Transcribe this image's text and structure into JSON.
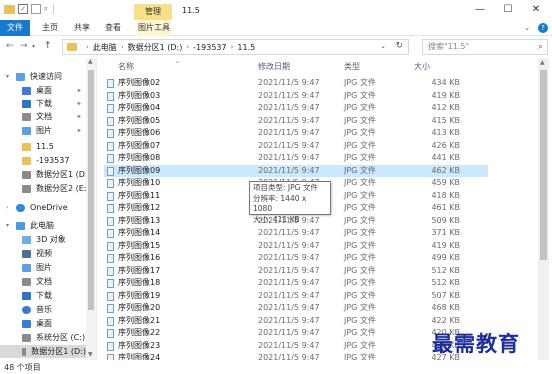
{
  "window": {
    "title": "11.5",
    "context_tab": "管理",
    "minimize_glyph": "—",
    "maximize_glyph": "☐",
    "close_glyph": "✕"
  },
  "ribbon": {
    "tabs": [
      "文件",
      "主页",
      "共享",
      "查看",
      "图片工具"
    ]
  },
  "address": {
    "crumbs": [
      "此电脑",
      "数据分区1 (D:)",
      "-193537",
      "11.5"
    ],
    "search_placeholder": "搜索\"11.5\""
  },
  "sidebar": {
    "items": [
      {
        "label": "快速访问",
        "icon": "star-icon"
      },
      {
        "label": "桌面",
        "icon": "desktop-icon",
        "pinned": true
      },
      {
        "label": "下载",
        "icon": "download-icon",
        "pinned": true
      },
      {
        "label": "文档",
        "icon": "document-icon",
        "pinned": true
      },
      {
        "label": "图片",
        "icon": "picture-icon",
        "pinned": true
      },
      {
        "label": "11.5",
        "icon": "folder-icon"
      },
      {
        "label": "-193537",
        "icon": "folder-icon"
      },
      {
        "label": "数据分区1 (D:)",
        "icon": "drive-icon"
      },
      {
        "label": "数据分区2 (E:)",
        "icon": "drive-icon"
      },
      {
        "label": "OneDrive",
        "icon": "cloud-icon"
      },
      {
        "label": "此电脑",
        "icon": "computer-icon"
      },
      {
        "label": "3D 对象",
        "icon": "cube-icon"
      },
      {
        "label": "视频",
        "icon": "video-icon"
      },
      {
        "label": "图片",
        "icon": "picture-icon"
      },
      {
        "label": "文档",
        "icon": "document-icon"
      },
      {
        "label": "下载",
        "icon": "download-icon"
      },
      {
        "label": "音乐",
        "icon": "music-icon"
      },
      {
        "label": "桌面",
        "icon": "desktop-icon"
      },
      {
        "label": "系统分区 (C:)",
        "icon": "drive-icon"
      },
      {
        "label": "数据分区1 (D:)",
        "icon": "drive-icon"
      }
    ]
  },
  "columns": {
    "name": "名称",
    "date": "修改日期",
    "type": "类型",
    "size": "大小"
  },
  "files": [
    {
      "name": "序列图像02",
      "date": "2021/11/5 9:47",
      "type": "JPG 文件",
      "size": "434 KB"
    },
    {
      "name": "序列图像03",
      "date": "2021/11/5 9:47",
      "type": "JPG 文件",
      "size": "419 KB"
    },
    {
      "name": "序列图像04",
      "date": "2021/11/5 9:47",
      "type": "JPG 文件",
      "size": "412 KB"
    },
    {
      "name": "序列图像05",
      "date": "2021/11/5 9:47",
      "type": "JPG 文件",
      "size": "415 KB"
    },
    {
      "name": "序列图像06",
      "date": "2021/11/5 9:47",
      "type": "JPG 文件",
      "size": "413 KB"
    },
    {
      "name": "序列图像07",
      "date": "2021/11/5 9:47",
      "type": "JPG 文件",
      "size": "426 KB"
    },
    {
      "name": "序列图像08",
      "date": "2021/11/5 9:47",
      "type": "JPG 文件",
      "size": "441 KB"
    },
    {
      "name": "序列图像09",
      "date": "2021/11/5 9:47",
      "type": "JPG 文件",
      "size": "462 KB"
    },
    {
      "name": "序列图像10",
      "date": "2021/11/5 9:47",
      "type": "JPG 文件",
      "size": "459 KB"
    },
    {
      "name": "序列图像11",
      "date": "2021/11/5 9:47",
      "type": "JPG 文件",
      "size": "418 KB"
    },
    {
      "name": "序列图像12",
      "date": "2021/11/5 9:47",
      "type": "JPG 文件",
      "size": "461 KB"
    },
    {
      "name": "序列图像13",
      "date": "2021/11/5 9:47",
      "type": "JPG 文件",
      "size": "509 KB"
    },
    {
      "name": "序列图像14",
      "date": "2021/11/5 9:47",
      "type": "JPG 文件",
      "size": "371 KB"
    },
    {
      "name": "序列图像15",
      "date": "2021/11/5 9:47",
      "type": "JPG 文件",
      "size": "419 KB"
    },
    {
      "name": "序列图像16",
      "date": "2021/11/5 9:47",
      "type": "JPG 文件",
      "size": "499 KB"
    },
    {
      "name": "序列图像17",
      "date": "2021/11/5 9:47",
      "type": "JPG 文件",
      "size": "512 KB"
    },
    {
      "name": "序列图像18",
      "date": "2021/11/5 9:47",
      "type": "JPG 文件",
      "size": "512 KB"
    },
    {
      "name": "序列图像19",
      "date": "2021/11/5 9:47",
      "type": "JPG 文件",
      "size": "507 KB"
    },
    {
      "name": "序列图像20",
      "date": "2021/11/5 9:47",
      "type": "JPG 文件",
      "size": "468 KB"
    },
    {
      "name": "序列图像21",
      "date": "2021/11/5 9:47",
      "type": "JPG 文件",
      "size": "422 KB"
    },
    {
      "name": "序列图像22",
      "date": "2021/11/5 9:47",
      "type": "JPG 文件",
      "size": "420 KB"
    },
    {
      "name": "序列图像23",
      "date": "2021/11/5 9:47",
      "type": "JPG 文件",
      "size": "426 KB"
    },
    {
      "name": "序列图像24",
      "date": "2021/11/5 9:47",
      "type": "JPG 文件",
      "size": "427 KB"
    }
  ],
  "selected_file": "序列图像09",
  "tooltip": {
    "line1": "项目类型: JPG 文件",
    "line2": "分辨率: 1440 x 1080",
    "line3": "大小: 411 KB"
  },
  "status": {
    "count": "48 个项目"
  },
  "watermark": "最需教育",
  "colors": {
    "accent": "#1979ca",
    "manage_tab": "#f7e08a",
    "selection": "#cce8ff",
    "watermark": "#1d2d9a"
  }
}
